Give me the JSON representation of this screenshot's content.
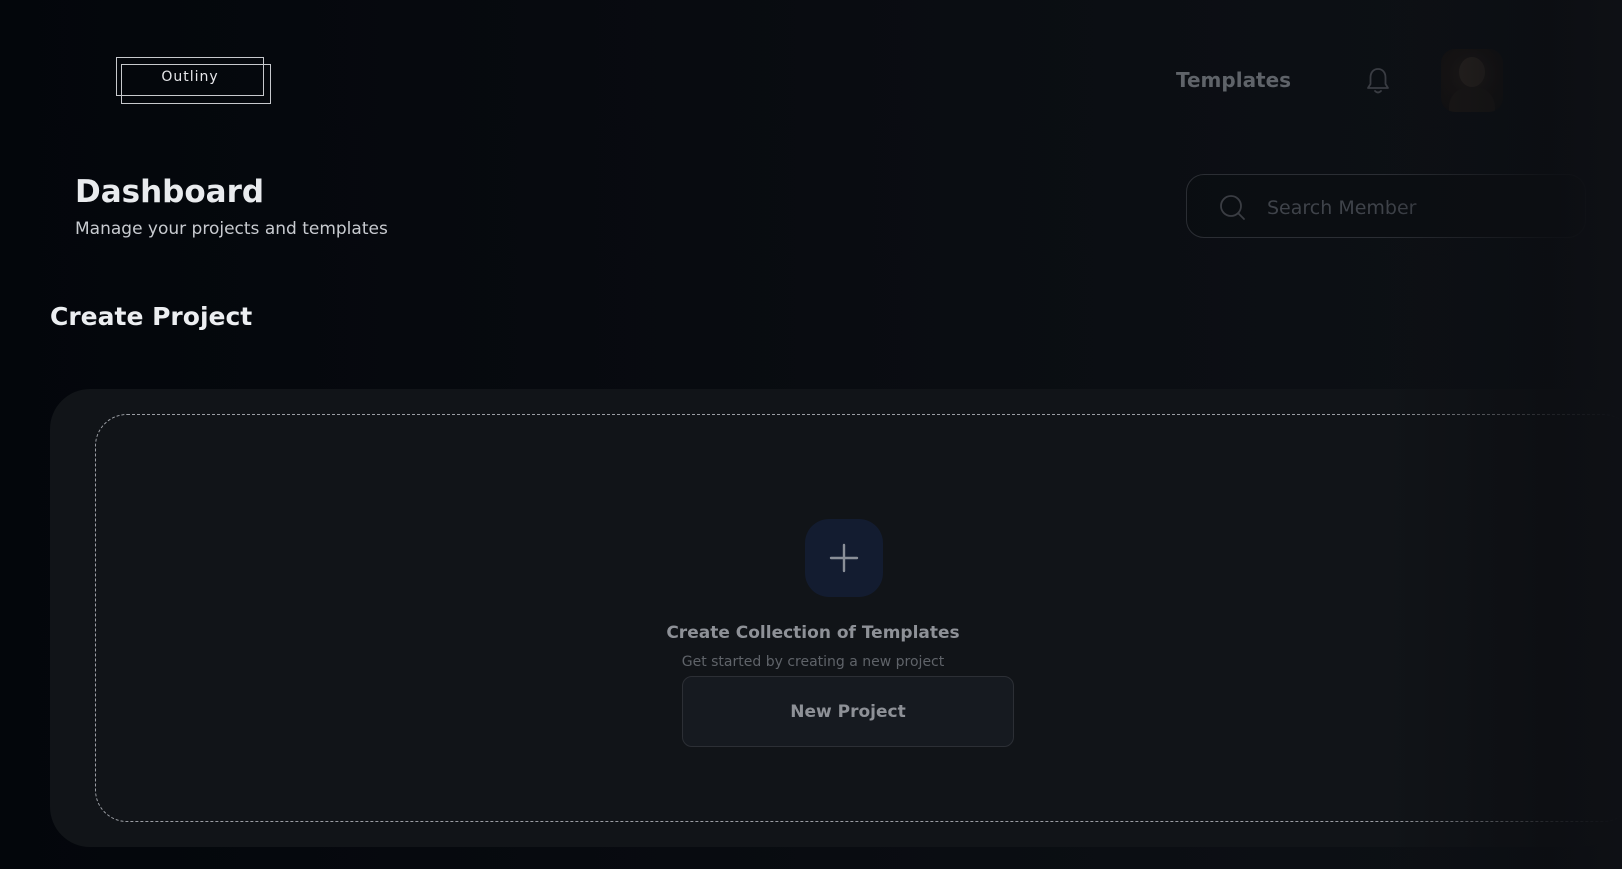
{
  "brand": {
    "logo_text": "Outliny"
  },
  "nav": {
    "templates_label": "Templates"
  },
  "header": {
    "title": "Dashboard",
    "subtitle": "Manage your projects and templates"
  },
  "search": {
    "placeholder": "Search Member"
  },
  "section": {
    "title": "Create Project"
  },
  "empty_state": {
    "title": "Create Collection of Templates",
    "subtitle": "Get started by creating a new project",
    "button_label": "New Project"
  },
  "icons": {
    "notifications": "bell-icon",
    "search": "search-icon",
    "add": "plus-icon"
  },
  "colors": {
    "background": "#04070c",
    "card": "#111418",
    "add_icon_bg": "#131c30"
  }
}
